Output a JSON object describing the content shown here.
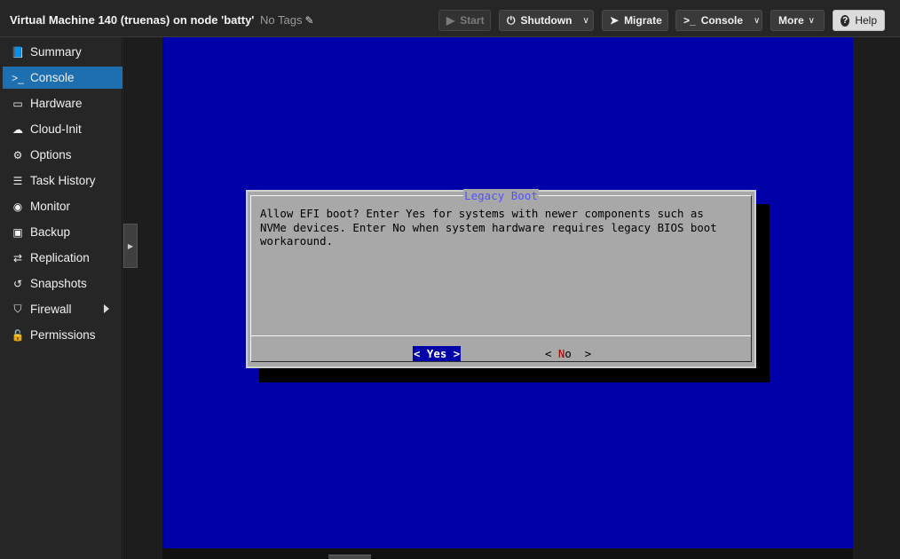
{
  "header": {
    "title": "Virtual Machine 140 (truenas) on node 'batty'",
    "tags_label": "No Tags",
    "buttons": {
      "start": "Start",
      "shutdown": "Shutdown",
      "migrate": "Migrate",
      "console": "Console",
      "more": "More",
      "help": "Help"
    }
  },
  "sidebar": {
    "items": [
      {
        "label": "Summary",
        "icon": "book-icon"
      },
      {
        "label": "Console",
        "icon": "terminal-icon"
      },
      {
        "label": "Hardware",
        "icon": "monitor-icon"
      },
      {
        "label": "Cloud-Init",
        "icon": "cloud-icon"
      },
      {
        "label": "Options",
        "icon": "gear-icon"
      },
      {
        "label": "Task History",
        "icon": "list-icon"
      },
      {
        "label": "Monitor",
        "icon": "eye-icon"
      },
      {
        "label": "Backup",
        "icon": "floppy-icon"
      },
      {
        "label": "Replication",
        "icon": "retweet-icon"
      },
      {
        "label": "Snapshots",
        "icon": "history-icon"
      },
      {
        "label": "Firewall",
        "icon": "shield-icon"
      },
      {
        "label": "Permissions",
        "icon": "unlock-icon"
      }
    ],
    "active_item": "Console"
  },
  "console": {
    "dialog": {
      "title": "Legacy Boot",
      "message": "Allow EFI boot? Enter Yes for systems with newer components such as\nNVMe devices. Enter No when system hardware requires legacy BIOS boot\nworkaround.",
      "yes_label": "< Yes >",
      "no_prefix": "< ",
      "no_hotkey": "N",
      "no_rest": "o  >"
    }
  },
  "colors": {
    "accent": "#1e6fb0",
    "console_bg": "#0000a8",
    "dialog_bg": "#a8a8a8",
    "dialog_title": "#5252ff",
    "hotkey": "#a80000"
  }
}
